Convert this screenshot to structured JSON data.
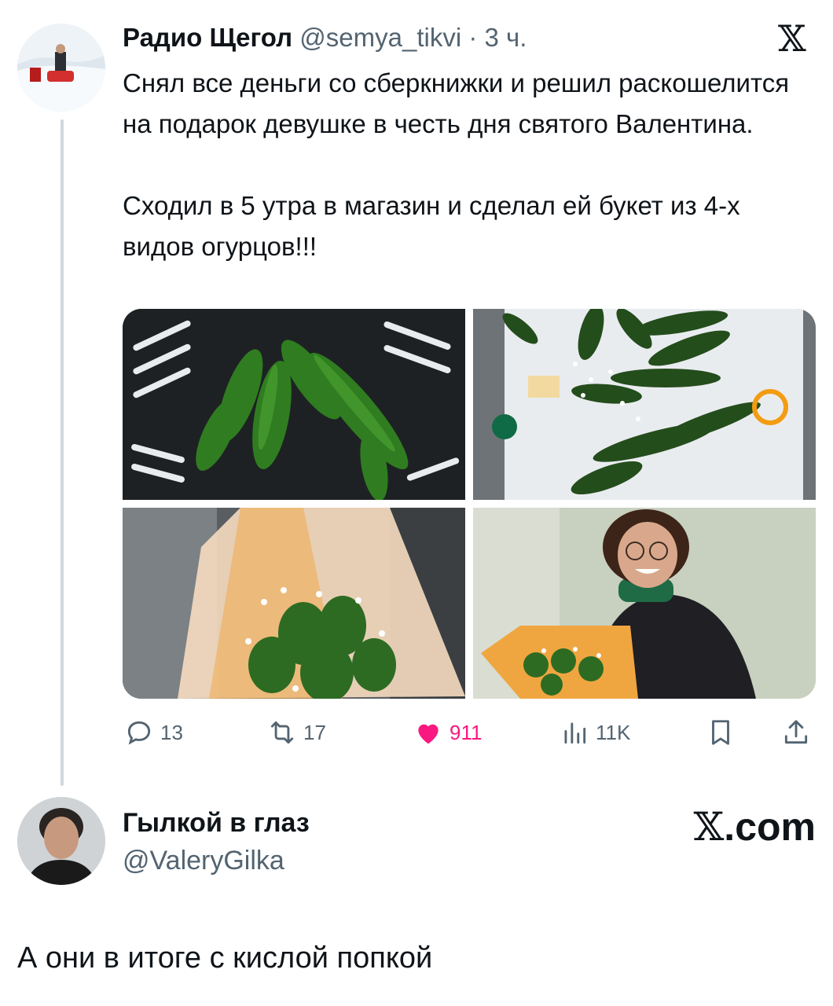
{
  "tweet": {
    "author_name": "Радио Щегол",
    "handle": "@semya_tikvi",
    "separator": "·",
    "time": "3 ч.",
    "platform_logo": "𝕏",
    "paragraphs": [
      "Снял все деньги со сберкнижки и решил раскошелится на подарок девушке в честь дня святого Валентина.",
      "Сходил в 5 утра в магазин и сделал ей букет из 4-х видов огурцов!!!"
    ],
    "actions": {
      "replies": "13",
      "retweets": "17",
      "likes": "911",
      "views": "11K"
    },
    "icons": [
      "reply-icon",
      "retweet-icon",
      "heart-icon",
      "views-icon",
      "bookmark-icon",
      "share-icon"
    ],
    "colors": {
      "like": "#f91880",
      "muted": "#536471"
    }
  },
  "reply": {
    "author_name": "Гылкой в глаз",
    "handle": "@ValeryGilka",
    "watermark": "X.com",
    "watermark_x": "𝕏",
    "watermark_suffix": ".com",
    "text": "А они в итоге с кислой попкой"
  }
}
